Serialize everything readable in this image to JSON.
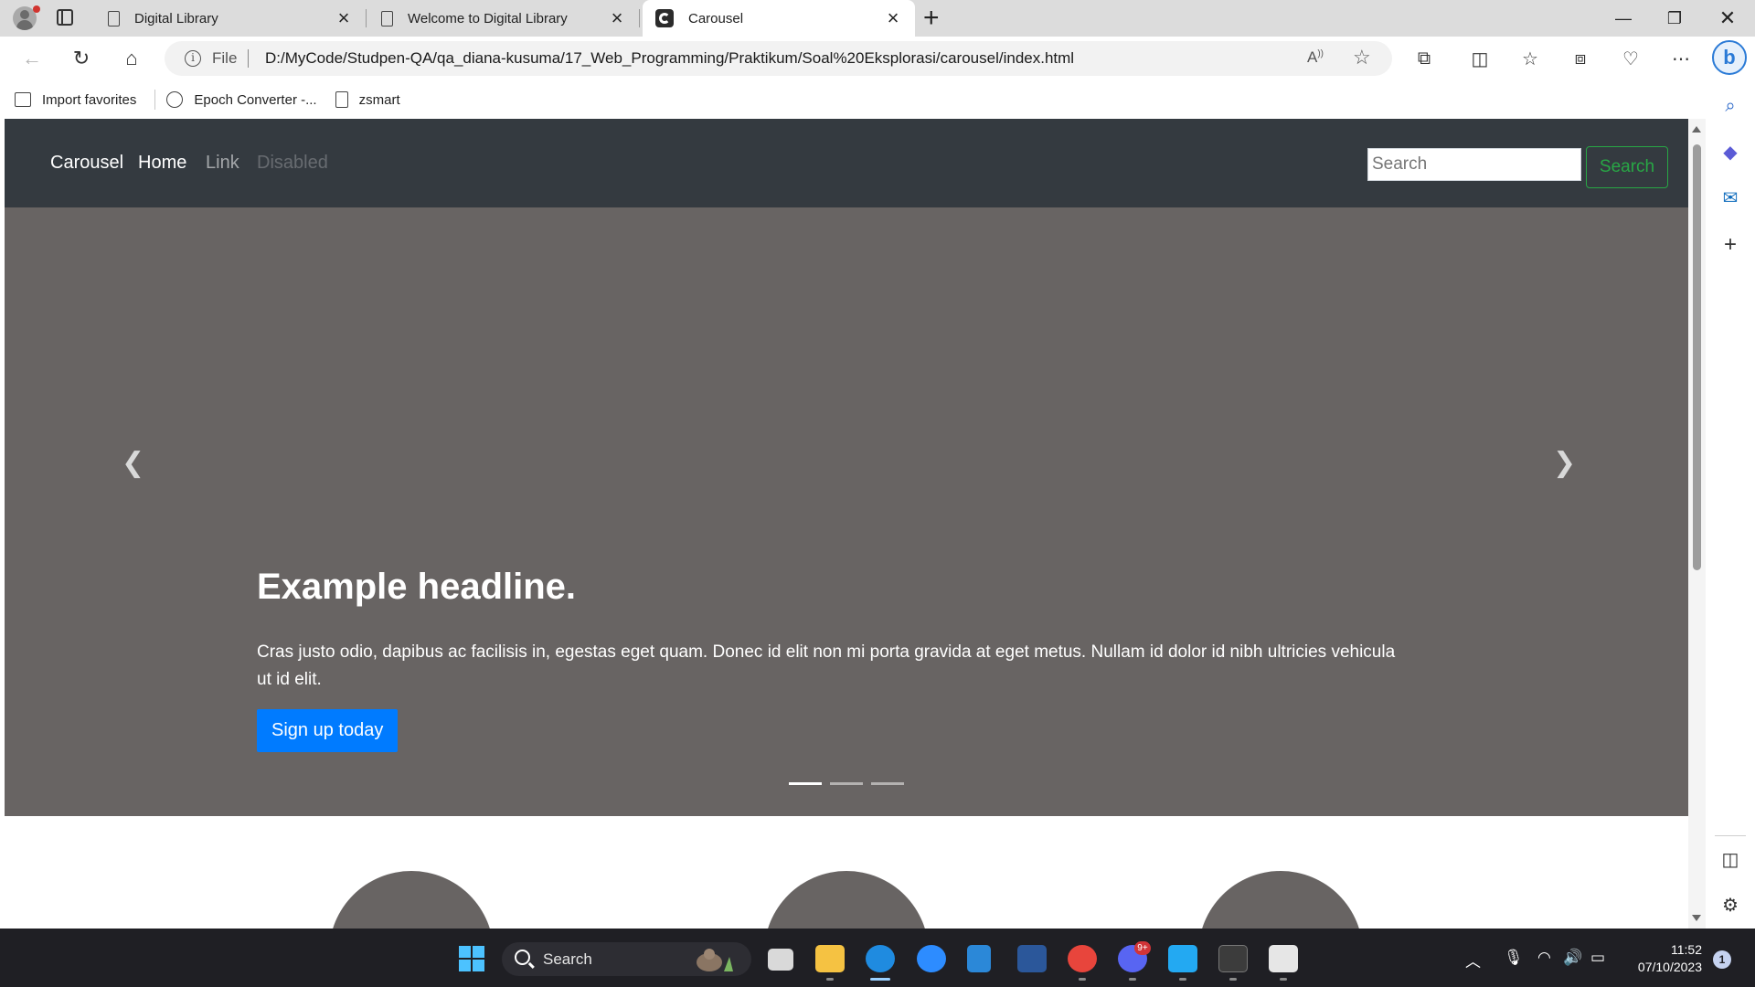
{
  "browser": {
    "tabs": [
      {
        "title": "Digital Library",
        "active": false
      },
      {
        "title": "Welcome to Digital Library",
        "active": false
      },
      {
        "title": "Carousel",
        "active": true
      }
    ],
    "address": {
      "scheme_label": "File",
      "url": "D:/MyCode/Studpen-QA/qa_diana-kusuma/17_Web_Programming/Praktikum/Soal%20Eksplorasi/carousel/index.html"
    },
    "favorites": [
      "Import favorites",
      "Epoch Converter -...",
      "zsmart"
    ]
  },
  "page": {
    "navbar": {
      "brand": "Carousel",
      "links": [
        "Home",
        "Link",
        "Disabled"
      ],
      "search_placeholder": "Search",
      "search_button": "Search"
    },
    "carousel": {
      "headline": "Example headline.",
      "text": "Cras justo odio, dapibus ac facilisis in, egestas eget quam. Donec id elit non mi porta gravida at eget metus. Nullam id dolor id nibh ultricies vehicula ut id elit.",
      "button": "Sign up today",
      "slides": 3,
      "active_slide": 1
    },
    "colors": {
      "navbar": "#343a40",
      "carousel_bg": "#686463",
      "primary": "#007bff",
      "success": "#28a745"
    }
  },
  "taskbar": {
    "search_label": "Search",
    "badge": "9+",
    "time": "11:52",
    "date": "07/10/2023",
    "notifications": "1"
  }
}
